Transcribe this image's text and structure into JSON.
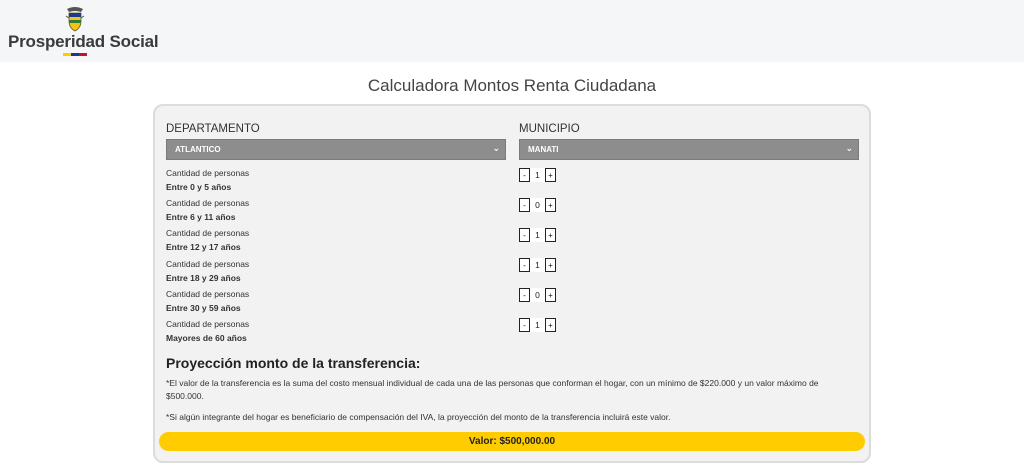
{
  "brand": {
    "name": "Prosperidad Social",
    "colors": {
      "yellow": "#ffcc00",
      "blue": "#1d3a8a",
      "red": "#c8102e"
    }
  },
  "page": {
    "title": "Calculadora Montos Renta Ciudadana"
  },
  "form": {
    "departamento": {
      "label": "DEPARTAMENTO",
      "value": "ATLANTICO"
    },
    "municipio": {
      "label": "MUNICIPIO",
      "value": "MANATI"
    },
    "rows": [
      {
        "label": "Cantidad de personas",
        "range": "Entre 0 y 5 años",
        "value": "1"
      },
      {
        "label": "Cantidad de personas",
        "range": "Entre 6 y 11 años",
        "value": "0"
      },
      {
        "label": "Cantidad de personas",
        "range": "Entre 12 y 17 años",
        "value": "1"
      },
      {
        "label": "Cantidad de personas",
        "range": "Entre 18 y 29 años",
        "value": "1"
      },
      {
        "label": "Cantidad de personas",
        "range": "Entre 30 y 59 años",
        "value": "0"
      },
      {
        "label": "Cantidad de personas",
        "range": "Mayores de 60 años",
        "value": "1"
      }
    ],
    "minus": "-",
    "plus": "+"
  },
  "projection": {
    "title": "Proyección monto de la transferencia:",
    "note1": "*El valor de la transferencia es la suma del costo mensual individual de cada una de las personas que conforman el hogar, con un mínimo de $220.000 y un valor máximo de $500.000.",
    "note2": "*Si algún integrante del hogar es beneficiario de compensación del IVA, la proyección del monto de la transferencia incluirá este valor.",
    "result": "Valor: $500,000.00"
  }
}
